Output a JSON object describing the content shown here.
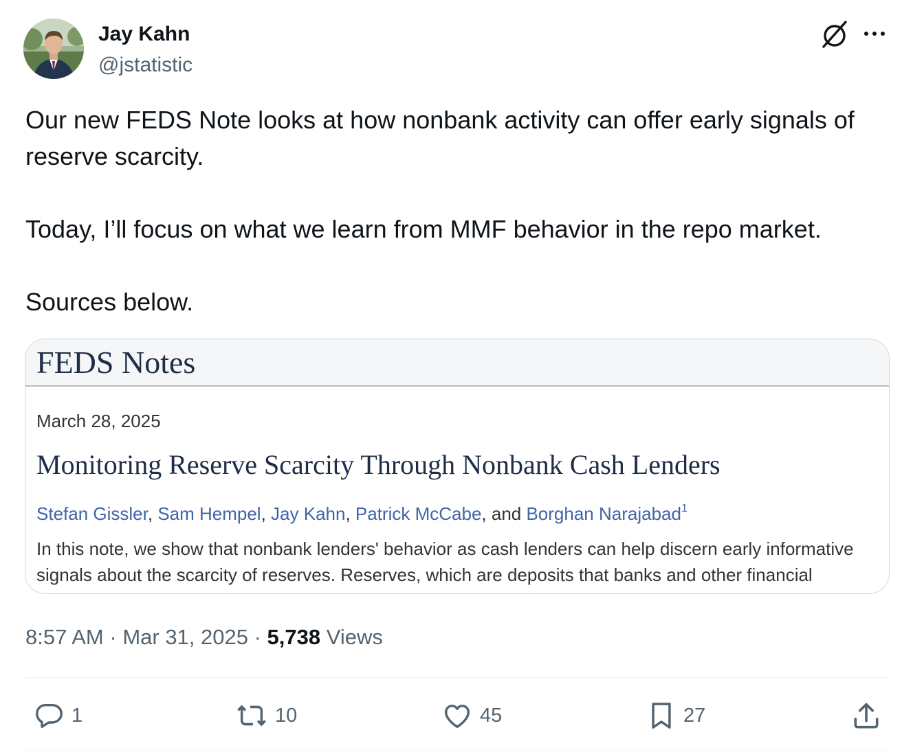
{
  "author": {
    "name": "Jay Kahn",
    "handle": "@jstatistic",
    "avatar_icon": "profile-photo"
  },
  "header_icons": {
    "grok": "grok-icon",
    "more": "more-icon"
  },
  "tweet": {
    "paragraphs": [
      "Our new FEDS Note looks at how nonbank activity can offer early signals of reserve scarcity.",
      "Today, I’ll focus on what we learn from MMF behavior in the repo market.",
      "Sources below."
    ]
  },
  "card": {
    "brand": "FEDS Notes",
    "date": "March 28, 2025",
    "title": "Monitoring Reserve Scarcity Through Nonbank Cash Lenders",
    "authors": [
      "Stefan Gissler",
      "Sam Hempel",
      "Jay Kahn",
      "Patrick McCabe",
      "Borghan Narajabad"
    ],
    "author_sep": ", ",
    "author_and": ", and ",
    "footnote": "1",
    "abstract": "In this note, we show that nonbank lenders' behavior as cash lenders can help discern early informative signals about the scarcity of reserves. Reserves, which are deposits that banks and other financial"
  },
  "meta": {
    "time": "8:57 AM",
    "sep": " · ",
    "date": "Mar 31, 2025",
    "views_count": "5,738",
    "views_label": "Views"
  },
  "actions": {
    "replies": "1",
    "reposts": "10",
    "likes": "45",
    "bookmarks": "27"
  },
  "colors": {
    "text_primary": "#0f1419",
    "text_secondary": "#536471",
    "border": "#cfd9de",
    "card_link": "#3f64a8",
    "card_heading": "#1f2d46"
  }
}
